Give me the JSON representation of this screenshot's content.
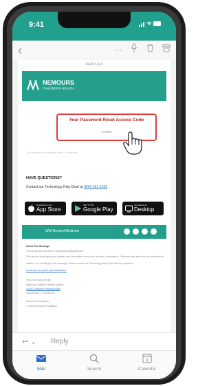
{
  "status_bar": {
    "time": "9:41",
    "icons": "signal-wifi-battery"
  },
  "mail_toolbar": {
    "back_icon": "chevron-left-icon",
    "more_label": "···"
  },
  "email": {
    "preheader": "NEMOURS",
    "logo": {
      "name": "NEMOURS",
      "sub": "CHILDREN'S HEALTH"
    },
    "code_title": "Your Password Reset Access Code",
    "code_value": "273000",
    "expire_note": "This access code expires after 30 minutes.",
    "questions_heading": "HAVE QUESTIONS?",
    "contact_text": "Contact our Technology Help Desk at ",
    "contact_phone": "(844) 551-1263",
    "badges": [
      {
        "small": "Download on the",
        "large": "App Store"
      },
      {
        "small": "GET IT ON",
        "large": "Google Play"
      },
      {
        "small": "Get started on",
        "large": "Desktop"
      }
    ],
    "footer_tagline": "Well Beyond Medicine",
    "about_heading": "About This Message",
    "about_lines": [
      "This email was intended for tara.example@gmail.com",
      "This service email gives you updates and information about your Nemours relationship. This email was sent from an unmonitored",
      "mailbox. Do not Reply to this message. Please contact our Technology Help Desk with any questions.",
      "Learn how to protect your information."
    ],
    "sent_by_heading": "This email was sent by:",
    "sent_by_lines": [
      "Nemours Children's Health System",
      "10140 Centurion Parkway North",
      "Jacksonville, FL 32256 US"
    ],
    "foundation": "Nemours Foundation",
    "copyright": "© 2022 Nemours Foundation"
  },
  "reply_bar": {
    "label": "Reply"
  },
  "tab_bar": {
    "tabs": [
      {
        "label": "Mail"
      },
      {
        "label": "Search"
      },
      {
        "label": "Calendar"
      }
    ]
  },
  "colors": {
    "brand": "#239f8c",
    "highlight": "#e03a3a",
    "tab_active": "#2a6fce"
  }
}
